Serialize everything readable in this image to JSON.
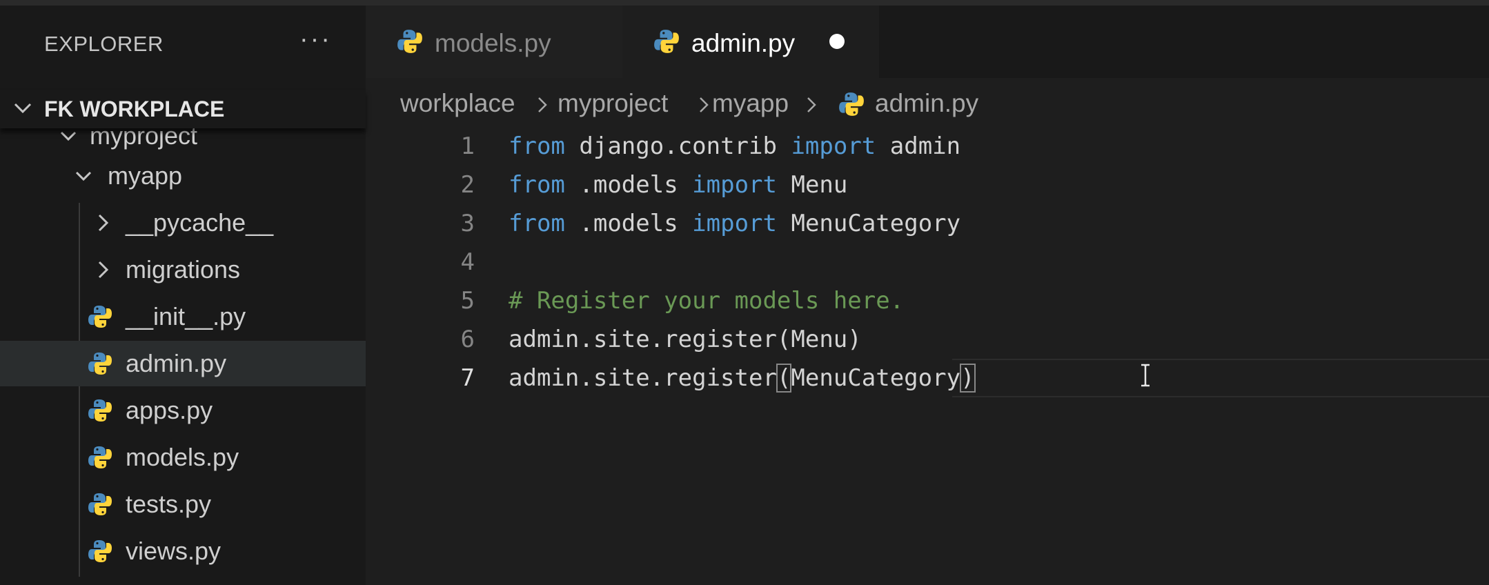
{
  "sidebar": {
    "title": "EXPLORER",
    "more_label": "···",
    "section_label": "FK WORKPLACE",
    "tree": {
      "myproject": "myproject",
      "myapp": "myapp",
      "pycache": "__pycache__",
      "migrations": "migrations",
      "init": "__init__.py",
      "admin": "admin.py",
      "apps": "apps.py",
      "models": "models.py",
      "tests": "tests.py",
      "views": "views.py"
    },
    "selected_file": "admin.py"
  },
  "tabs": [
    {
      "label": "models.py",
      "active": false,
      "icon": "python-icon"
    },
    {
      "label": "admin.py",
      "active": true,
      "icon": "python-icon",
      "dirty": true
    }
  ],
  "breadcrumb": [
    "workplace",
    "myproject",
    "myapp",
    "admin.py"
  ],
  "editor": {
    "line_numbers": [
      "1",
      "2",
      "3",
      "4",
      "5",
      "6",
      "7"
    ],
    "current_line": 7,
    "lines": [
      {
        "from": "from",
        "module": "django.contrib",
        "import": "import",
        "name": "admin"
      },
      {
        "from": "from",
        "module": ".models",
        "import": "import",
        "name": "Menu"
      },
      {
        "from": "from",
        "module": ".models",
        "import": "import",
        "name": "MenuCategory"
      },
      {},
      {
        "comment": "# Register your models here."
      },
      {
        "text": "admin.site.register(Menu)"
      },
      {
        "prefix": "admin.site.register",
        "open": "(",
        "arg": "MenuCategory",
        "close": ")"
      }
    ]
  },
  "colors": {
    "background": "#1e1e1e",
    "sidebar": "#191919",
    "keyword": "#569cd6",
    "comment": "#6a9955",
    "text": "#d4d4d4",
    "python_blue": "#4b8bbe",
    "python_yellow": "#ffd43b"
  }
}
